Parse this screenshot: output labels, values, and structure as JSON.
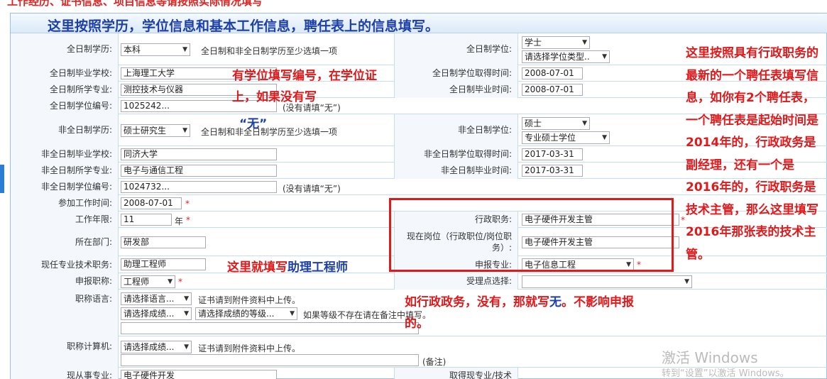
{
  "header": {
    "title": "这里按照学历，学位信息和基本工作信息，聘任表上的信息填写。"
  },
  "top_strip": {
    "text": "工作经历、证书信息、项目信息等请按照实际情况填写"
  },
  "rows": {
    "ft_edu": {
      "label": "全日制学历:",
      "value": "本科",
      "hint": "全日制和非全日制学历至少选填一项"
    },
    "ft_degree": {
      "label": "全日制学位:",
      "value": "学士",
      "type_placeholder": "请选择学位类型.."
    },
    "ft_school": {
      "label": "全日制毕业学校:",
      "value": "上海理工大学"
    },
    "ft_degree_date": {
      "label": "全日制学位取得时间:",
      "value": "2008-07-01"
    },
    "ft_major": {
      "label": "全日制所学专业:",
      "value": "测控技术与仪器"
    },
    "ft_grad_date": {
      "label": "全日制毕业时间:",
      "value": "2008-07-01"
    },
    "ft_degree_no": {
      "label": "全日制学位编号:",
      "value": "1025242...",
      "hint": "(没有请填“无”)"
    },
    "pt_edu": {
      "label": "非全日制学历:",
      "value": "硕士研究生",
      "hint": "全日制和非全日制学历至少选填一项"
    },
    "pt_degree": {
      "label": "非全日制学位:",
      "value": "硕士",
      "type_value": "专业硕士学位"
    },
    "pt_school": {
      "label": "非全日制毕业学校:",
      "value": "同济大学"
    },
    "pt_degree_date": {
      "label": "非全日制学位取得时间:",
      "value": "2017-03-31"
    },
    "pt_major": {
      "label": "非全日制所学专业:",
      "value": "电子与通信工程"
    },
    "pt_grad_date": {
      "label": "非全日制毕业时间:",
      "value": "2017-03-31"
    },
    "pt_degree_no": {
      "label": "非全日制学位编号:",
      "value": "1024732...",
      "hint": "(没有请填“无”)"
    },
    "work_start": {
      "label": "参加工作时间:",
      "value": "2008-07-01"
    },
    "work_years": {
      "label": "工作年限:",
      "value": "11",
      "unit": "年"
    },
    "admin_duty": {
      "label": "行政职务:",
      "value": "电子硬件开发主管"
    },
    "department": {
      "label": "所在部门:",
      "value": "研发部"
    },
    "position": {
      "label": "现在岗位（行政职位/岗位职务）:",
      "value": "电子硬件开发主管"
    },
    "current_title": {
      "label": "现任专业技术职务:",
      "value": "助理工程师"
    },
    "apply_major": {
      "label": "申报专业:",
      "value": "电子信息工程"
    },
    "apply_title": {
      "label": "申报职称:",
      "value": "工程师"
    },
    "accept_point": {
      "label": "受理点选择:",
      "value": ""
    },
    "lang": {
      "label": "职称语言:",
      "lang_placeholder": "请选择语言...",
      "cert_hint": "证书请到附件资料中上传。",
      "grade_placeholder": "请选择成绩...",
      "level_placeholder": "请选择成绩的等级...",
      "level_hint": "如果等级不存在请在备注中填写。"
    },
    "computer": {
      "label": "职称计算机:",
      "grade_placeholder": "请选择成绩...",
      "cert_hint": "证书请到附件资料中上传。",
      "remark": "(备注)"
    },
    "current_field": {
      "label": "现从事专业:",
      "value": "电子硬件开发"
    },
    "obtain_field": {
      "label": "取得现专业/技术"
    }
  },
  "annotations": {
    "degree_no_note": "有学位填写编号，在学位证上，如果没有写",
    "degree_no_none": "“无”",
    "current_title_note_pre": "这里就填写",
    "current_title_note_blue": "助理工程师",
    "admin_note_pre": "如行政政务，没有，那就写",
    "admin_note_blue": "无",
    "admin_note_post": "。不影响申报的。",
    "right_note": "这里按照具有行政职务的最新的一个聘任表填写信息，如你有2个聘任表，一个聘任表是起始时间是2014年的，行政政务是副经理，还有一个是2016年的，行政职务是技术主管，那么这里填写2016年那张表的技术主管。"
  },
  "watermark": {
    "line1": "激活 Windows",
    "line2": "转到“设置”以激活 Windows。"
  },
  "colors": {
    "annotation_red": "#e0191b",
    "header_blue": "#1c3fa8",
    "border_blue": "#9cc0e4"
  }
}
